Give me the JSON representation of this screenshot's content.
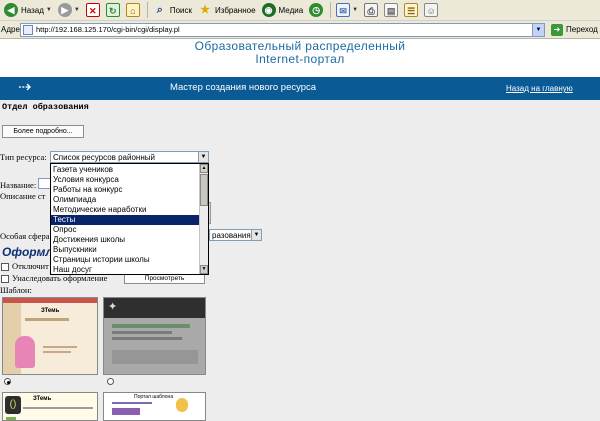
{
  "browser": {
    "toolbar": {
      "back_label": "Назад",
      "search_label": "Поиск",
      "favorites_label": "Избранное",
      "media_label": "Медиа"
    },
    "address": {
      "label": "Адрес:",
      "url": "http://192.168.125.170/cgi-bin/cgi/display.pl",
      "go_label": "Переход"
    }
  },
  "header": {
    "title_line1": "Образовательный распределенный",
    "title_line2": "Internet-портал",
    "band_title": "Мастер создания нового ресурса",
    "home_link": "Назад на главную",
    "band_color": "#0a5a96",
    "title_color": "#1b6aa3"
  },
  "form": {
    "department": "Отдел образования",
    "more_button": "Более подробно...",
    "resource_type_label": "Тип ресурса:",
    "resource_type_value": "Список ресурсов районный",
    "name_label": "Название:",
    "description_label": "Описание ст",
    "sphere_label": "Особая сфера",
    "sphere_value": "разования",
    "design_heading": "Оформл",
    "disable_label": "Отключит",
    "inherit_label": "Унаследовать оформление",
    "preview_button": "Просмотреть",
    "template_label": "Шаблон:"
  },
  "dropdown": {
    "items": [
      "Газета учеников",
      "Условия конкурса",
      "Работы на конкурс",
      "Олимпиада",
      "Методические наработки",
      "Тесты",
      "Опрос",
      "Достижения школы",
      "Выпускники",
      "Страницы истории школы",
      "Наш досуг"
    ],
    "selected_index": 5,
    "selected_color": "#0a246a"
  },
  "templates": {
    "thumb_tl_title": "ЗТемь",
    "thumb_bl_title": "ЗТемь",
    "thumb_br_title": "Портал шаблона",
    "selected_template_index": 0
  }
}
